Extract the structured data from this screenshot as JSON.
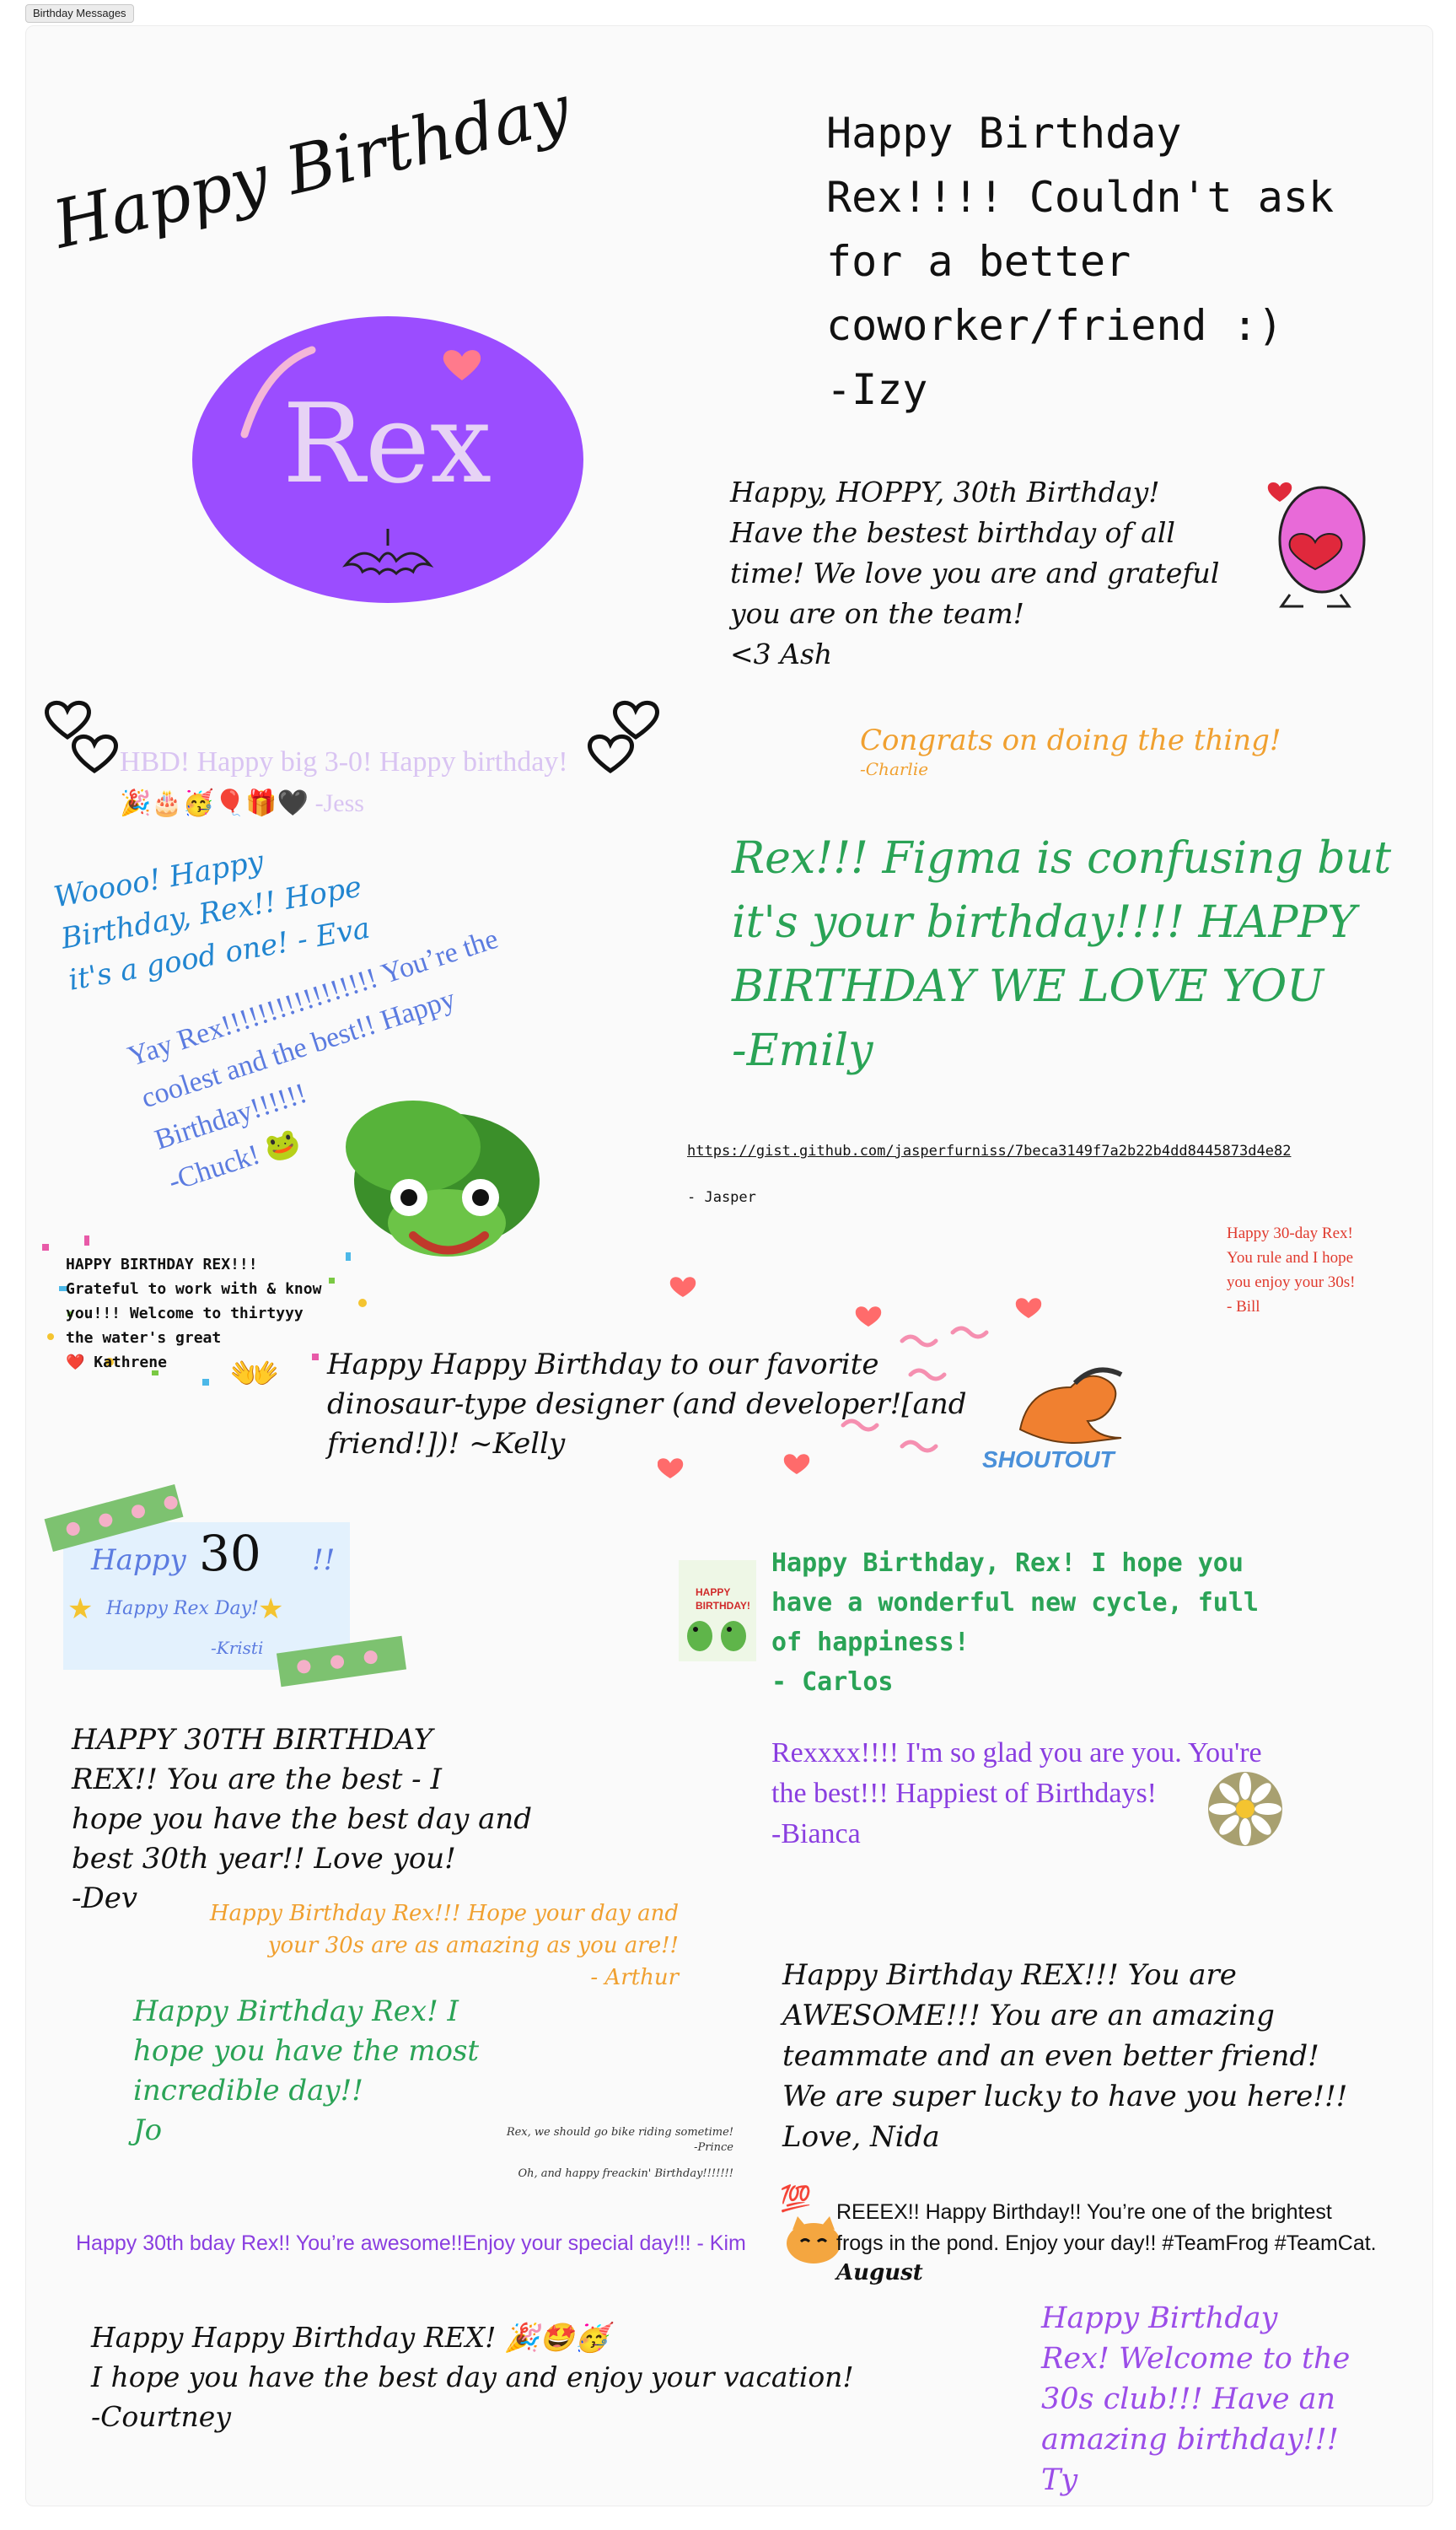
{
  "window": {
    "tab_label": "Birthday Messages"
  },
  "title_art": {
    "heading": "Happy Birthday",
    "name": "Rex"
  },
  "messages": {
    "izy": "Happy Birthday\nRex!!!! Couldn't ask\nfor a better\ncoworker/friend :)\n-Izy",
    "ash": "Happy, HOPPY, 30th Birthday!\nHave the bestest birthday of all\ntime! We love you are and grateful\nyou are on the team!\n<3 Ash",
    "jess": "HBD! Happy big 3-0! Happy birthday!",
    "jess_sig": "🎉🎂🥳🎈🎁🖤 -Jess",
    "charlie": "Congrats on doing the thing!",
    "charlie_sig": "-Charlie",
    "eva": "Woooo! Happy\nBirthday, Rex!! Hope\nit's a good one! - Eva",
    "emily": "Rex!!! Figma is confusing but\nit's your birthday!!!! HAPPY\nBIRTHDAY WE LOVE YOU\n-Emily",
    "chuck": "Yay Rex!!!!!!!!!!!!!!!!! You’re the\ncoolest and the best!! Happy\nBirthday!!!!!!\n-Chuck! 🐸",
    "jasper_link": "https://gist.github.com/jasperfurniss/7beca3149f7a2b22b4dd8445873d4e82",
    "jasper_sig": "- Jasper",
    "bill": "Happy 30-day Rex!\nYou rule and I hope\nyou enjoy your 30s!\n- Bill",
    "kathrene": "HAPPY BIRTHDAY REX!!!\nGrateful to work with & know\nyou!!! Welcome to thirtyyy\nthe water's great\n❤️ Kathrene",
    "kelly": "Happy Happy Birthday to our favorite\ndinosaur-type designer (and developer![and\nfriend!])!    ~Kelly",
    "shoutout": "SHOUTOUT",
    "kristi_title": "Happy",
    "kristi_num": "30",
    "kristi_bang": "!!",
    "kristi_line": "Happy Rex Day!",
    "kristi_sig": "-Kristi",
    "carlos": "Happy Birthday, Rex! I hope you\nhave a wonderful new cycle, full\nof happiness!\n- Carlos",
    "carlos_card": "HAPPY\nBIRTHDAY!",
    "dev": "HAPPY 30TH BIRTHDAY\nREX!! You are the best - I\nhope you have the best day and\nbest 30th year!! Love you!\n-Dev",
    "bianca": "Rexxxx!!!! I'm so glad you are you. You're\nthe best!!! Happiest of Birthdays!\n-Bianca",
    "arthur": "Happy Birthday Rex!!! Hope your day and\nyour 30s are as amazing as you are!!\n- Arthur",
    "jo": "Happy Birthday Rex! I\nhope you have the most\nincredible day!!\nJo",
    "nida": "Happy Birthday REX!!! You are\nAWESOME!!! You are an amazing\nteammate and an even better friend!\nWe are super lucky to have you here!!!\nLove, Nida",
    "prince": "Rex, we should go bike riding sometime!\n-Prince",
    "prince_ps": "Oh, and happy freackin' Birthday!!!!!!!",
    "kim": "Happy 30th bday Rex!! You’re awesome!!Enjoy your special day!!! - Kim",
    "august": "REEEX!! Happy Birthday!! You’re one of the brightest\nfrogs in the pond. Enjoy your day!! #TeamFrog #TeamCat.",
    "august_sig": "August",
    "courtney": "Happy Happy Birthday REX!  🎉🤩🥳\nI hope you have the best day and enjoy your vacation!\n-Courtney",
    "ty": "Happy Birthday\nRex! Welcome to the\n30s club!!! Have an\namazing birthday!!!\nTy"
  },
  "colors": {
    "purple_circle": "#9b4dff",
    "lavender": "#d9c4f2",
    "orange": "#f0a030",
    "green": "#2aa356",
    "blue": "#2185d0",
    "periwinkle": "#5b7be0",
    "red": "#e03a2e",
    "violet": "#8a3ee0",
    "ty_violet": "#9b4de8"
  },
  "icons": [
    "heart-icon",
    "outline-heart-icon",
    "bat-icon",
    "frog-sticker",
    "dino-sticker",
    "daisy-sticker",
    "cat-sticker",
    "hundred-icon",
    "clap-icon",
    "star-icon"
  ]
}
